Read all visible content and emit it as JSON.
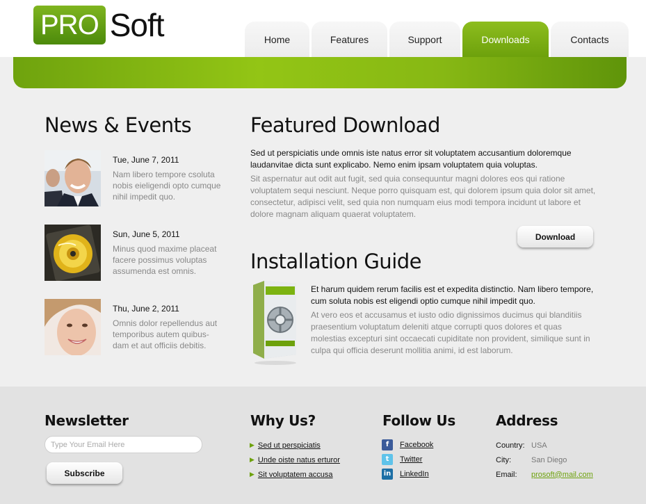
{
  "brand": {
    "logo_box": "PRO",
    "logo_text": "Soft",
    "accent": "#7cb311"
  },
  "nav": {
    "items": [
      {
        "label": "Home",
        "active": false
      },
      {
        "label": "Features",
        "active": false
      },
      {
        "label": "Support",
        "active": false
      },
      {
        "label": "Downloads",
        "active": true
      },
      {
        "label": "Contacts",
        "active": false
      }
    ]
  },
  "news": {
    "title": "News & Events",
    "items": [
      {
        "image": "businessmen-photo",
        "date": "Tue, June 7, 2011",
        "text": "Nam libero tempore csoluta nobis eieligendi opto cumque nihil impedit quo."
      },
      {
        "image": "cd-disc-photo",
        "date": "Sun, June 5, 2011",
        "text": "Minus quod maxime placeat facere possimus voluptas assumenda est omnis."
      },
      {
        "image": "smiling-woman-photo",
        "date": "Thu, June 2, 2011",
        "text": "Omnis dolor repellendus aut temporibus autem quibus-dam et aut officiis debitis."
      }
    ]
  },
  "featured": {
    "title": "Featured Download",
    "lead": "Sed ut perspiciatis unde omnis iste natus error sit voluptatem accusantium doloremque laudanvitae dicta sunt explicabo. Nemo enim ipsam voluptatem quia voluptas.",
    "body": "Sit aspernatur aut odit aut fugit, sed quia consequuntur magni dolores eos qui ratione voluptatem sequi nesciunt. Neque porro quisquam est, qui dolorem ipsum quia dolor sit amet, consectetur, adipisci velit, sed quia non numquam eius modi tempora incidunt ut labore et dolore magnam aliquam quaerat voluptatem.",
    "button": "Download"
  },
  "guide": {
    "title": "Installation Guide",
    "image": "software-box-icon",
    "lead": "Et harum quidem rerum facilis est et expedita distinctio. Nam libero tempore, cum soluta nobis est eligendi optio cumque nihil impedit quo.",
    "body": "At vero eos et accusamus et iusto odio dignissimos ducimus qui blanditiis praesentium voluptatum deleniti atque corrupti quos dolores et quas molestias excepturi sint occaecati cupiditate non provident, similique sunt in culpa qui officia deserunt mollitia animi, id est laborum."
  },
  "footer": {
    "newsletter": {
      "title": "Newsletter",
      "placeholder": "Type Your Email Here",
      "button": "Subscribe"
    },
    "why": {
      "title": "Why Us?",
      "links": [
        "Sed ut perspiciatis",
        "Unde oiste natus erturor",
        "Sit voluptatem accusa"
      ]
    },
    "follow": {
      "title": "Follow Us",
      "links": [
        {
          "icon": "facebook-icon",
          "glyph": "f",
          "label": "Facebook"
        },
        {
          "icon": "twitter-icon",
          "glyph": "t",
          "label": "Twitter"
        },
        {
          "icon": "linkedin-icon",
          "glyph": "in",
          "label": "LinkedIn"
        }
      ]
    },
    "address": {
      "title": "Address",
      "rows": [
        {
          "key": "Country:",
          "value": "USA"
        },
        {
          "key": "City:",
          "value": "San Diego"
        },
        {
          "key": "Email:",
          "value": "prosoft@mail.com"
        }
      ]
    }
  }
}
